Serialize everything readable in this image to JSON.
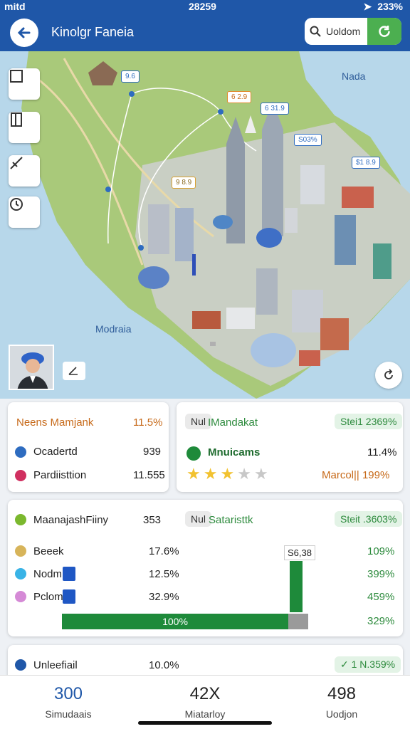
{
  "status": {
    "carrier": "mitd",
    "time": "28259",
    "battery": "233%"
  },
  "header": {
    "title": "Kinolgr Faneia",
    "search_text": "Uoldom"
  },
  "map": {
    "labels": {
      "north_east": "Nada",
      "south": "Modraia"
    },
    "pins": [
      "9.6",
      "6 2.9",
      "6 31.9",
      "9 8.9",
      "S03%",
      "$1 8.9"
    ]
  },
  "card_top_left": {
    "title": "Neens Mamjank",
    "title_value": "11.5%",
    "rows": [
      {
        "label": "Ocadertd",
        "value": "939"
      },
      {
        "label": "Pardiisttion",
        "value": "11.555"
      }
    ]
  },
  "card_top_right": {
    "badge": "Nul",
    "title": "IMandakat",
    "chip": "Stei1 2369%",
    "row1_label": "Mnuicams",
    "row1_value": "11.4%",
    "rating": 3,
    "rating_label": "Marcol|| 199%"
  },
  "card_middle": {
    "left_title": "MaanajashFiiny",
    "left_value": "353",
    "badge": "Nul",
    "right_title": "Sataristtk",
    "chip": "Steit .3603%",
    "bar_label": "S6,38",
    "rows": [
      {
        "label": "Beeek",
        "value": "17.6%",
        "right": "109%"
      },
      {
        "label": "Nodm",
        "value": "12.5%",
        "right": "399%"
      },
      {
        "label": "Pclom",
        "value": "32.9%",
        "right": "459%"
      }
    ],
    "progress_label": "100%",
    "progress_right": "329%",
    "progress": 1.0
  },
  "card_bottom": {
    "label": "Unleefiail",
    "value": "10.0%",
    "chip": "✓ 1 N.359%"
  },
  "bottom_bar": [
    {
      "value": "300",
      "label": "Simudaais"
    },
    {
      "value": "42X",
      "label": "Miatarloy"
    },
    {
      "value": "498",
      "label": "Uodjon"
    }
  ],
  "colors": {
    "primary": "#1f57a8",
    "accent": "#4caf50",
    "progress": "#1e8a3a",
    "title_orange": "#c76a1a"
  }
}
